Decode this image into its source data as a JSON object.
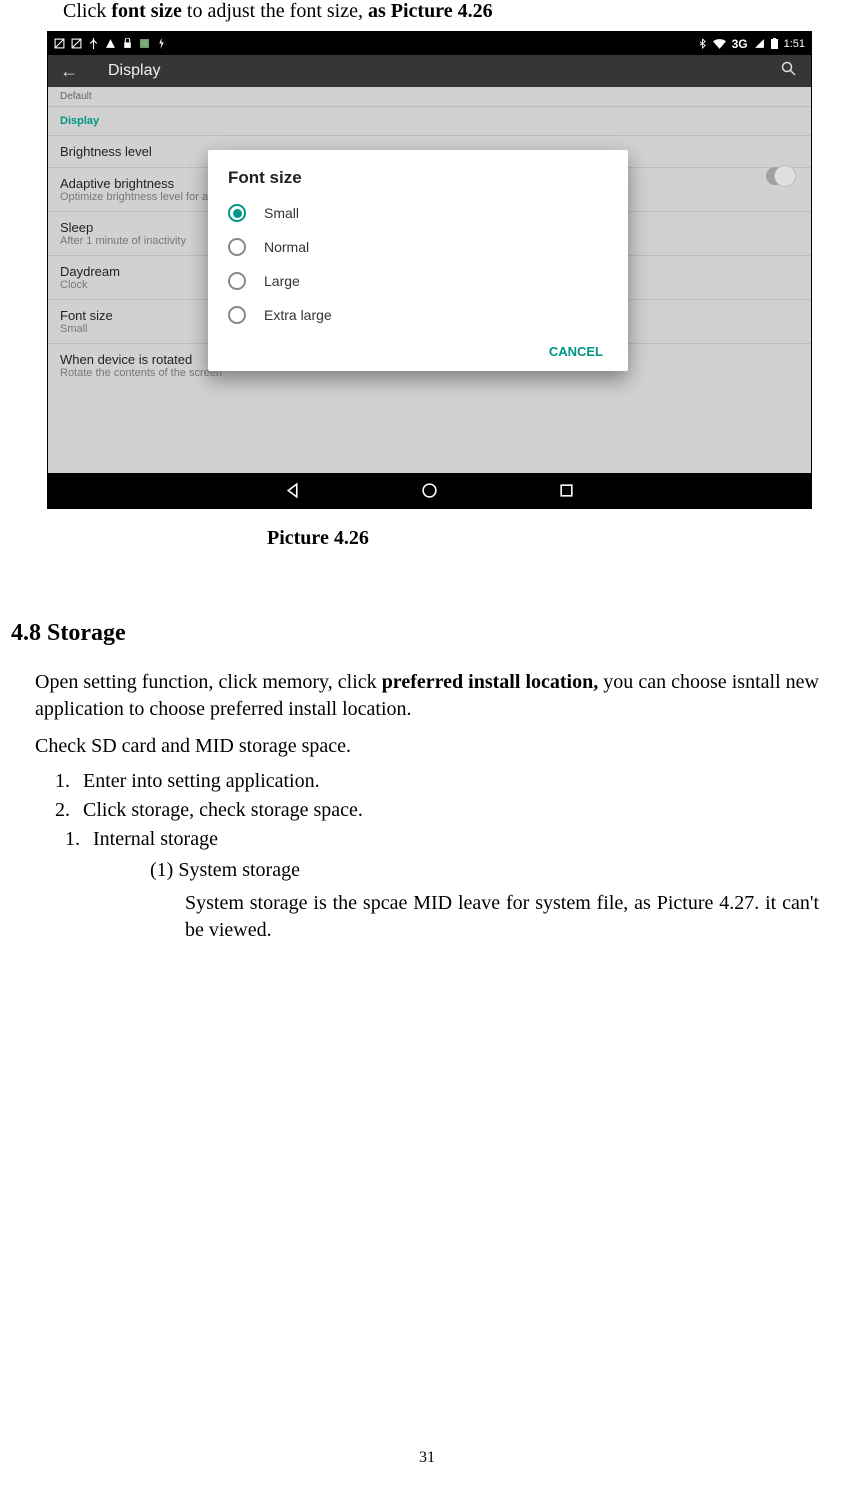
{
  "intro": {
    "prefix": "Click ",
    "bold1": "font size",
    "mid": " to adjust the font size, ",
    "bold2": "as Picture 4.26"
  },
  "screenshot": {
    "status": {
      "time": "1:51",
      "network": "3G"
    },
    "header": {
      "title": "Display"
    },
    "rows": {
      "default": "Default",
      "display": "Display",
      "brightness": "Brightness level",
      "adaptive": "Adaptive brightness",
      "adaptiveSub": "Optimize brightness level for a",
      "sleep": "Sleep",
      "sleepSub": "After 1 minute of inactivity",
      "daydream": "Daydream",
      "daydreamSub": "Clock",
      "fontsize": "Font size",
      "fontsizeSub": "Small",
      "rotate": "When device is rotated",
      "rotateSub": "Rotate the contents of the screen"
    },
    "dialog": {
      "title": "Font size",
      "options": [
        "Small",
        "Normal",
        "Large",
        "Extra large"
      ],
      "cancel": "CANCEL"
    }
  },
  "caption": "Picture 4.26",
  "section": {
    "number": "4.8",
    "title": "Storage",
    "para1_pre": "Open setting function, click memory, click ",
    "para1_bold": "preferred install location,",
    "para1_post": " you can choose isntall new application to choose preferred install location.",
    "para2": "Check SD card and MID storage space.",
    "li1": "Enter into setting application.",
    "li2": "Click storage, check storage space.",
    "sub1": "Internal storage",
    "paren1": "(1) System storage",
    "paren1desc": "System storage is the spcae MID leave for system file, as Picture 4.27. it can't be viewed."
  },
  "pageNum": "31"
}
